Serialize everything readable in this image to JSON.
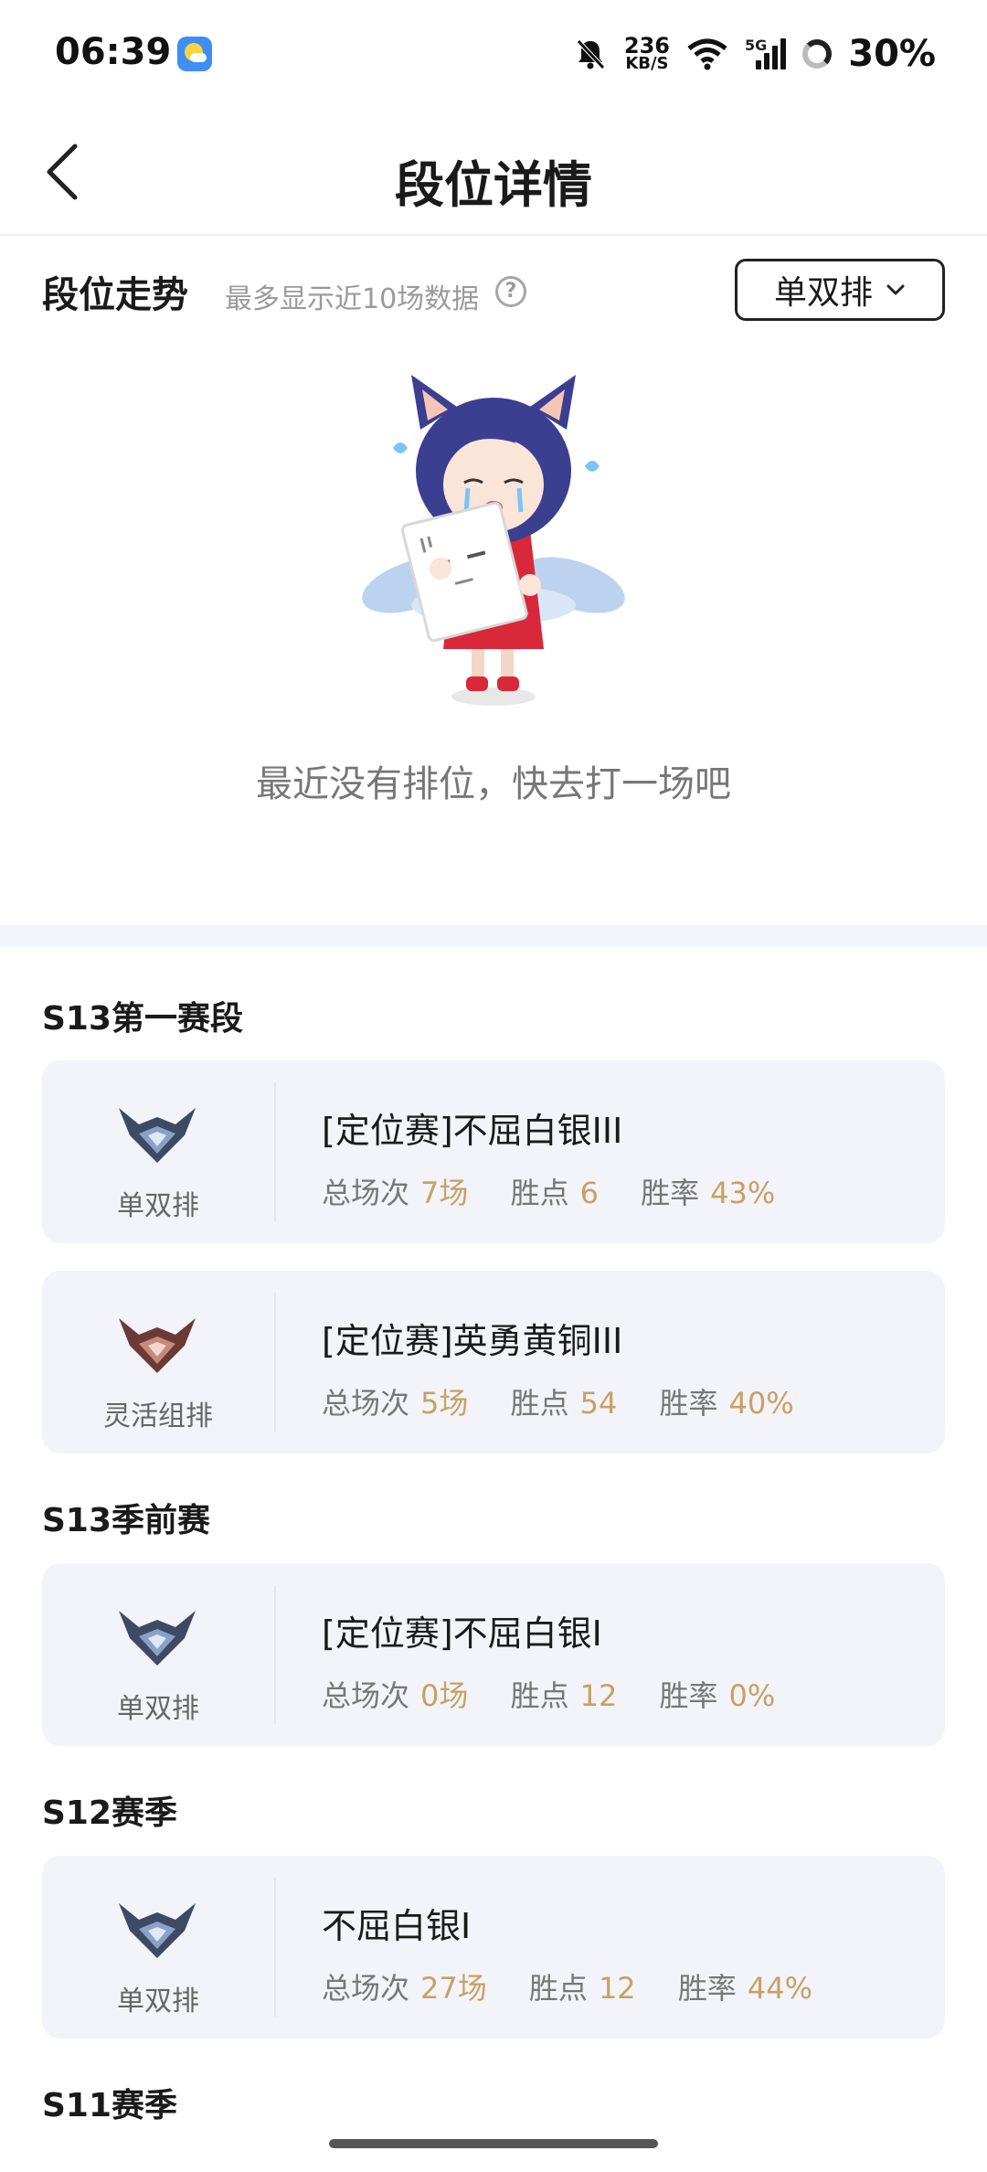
{
  "status_bar": {
    "time": "06:39",
    "net_speed_value": "236",
    "net_speed_unit": "KB/S",
    "network": "5G",
    "battery": "30%"
  },
  "header": {
    "title": "段位详情"
  },
  "trend": {
    "title": "段位走势",
    "hint": "最多显示近10场数据",
    "help_glyph": "?",
    "queue_selector": "单双排",
    "empty_message": "最近没有排位，快去打一场吧"
  },
  "labels": {
    "games": "总场次",
    "lp": "胜点",
    "winrate": "胜率"
  },
  "seasons": [
    {
      "title": "S13第一赛段",
      "cards": [
        {
          "queue": "单双排",
          "rank": "[定位赛]不屈白银III",
          "games": "7场",
          "lp": "6",
          "winrate": "43%",
          "emblem_color": "#3e4a63"
        },
        {
          "queue": "灵活组排",
          "rank": "[定位赛]英勇黄铜III",
          "games": "5场",
          "lp": "54",
          "winrate": "40%",
          "emblem_color": "#6b3a36"
        }
      ]
    },
    {
      "title": "S13季前赛",
      "cards": [
        {
          "queue": "单双排",
          "rank": "[定位赛]不屈白银I",
          "games": "0场",
          "lp": "12",
          "winrate": "0%",
          "emblem_color": "#3e4a63"
        }
      ]
    },
    {
      "title": "S12赛季",
      "cards": [
        {
          "queue": "单双排",
          "rank": "不屈白银I",
          "games": "27场",
          "lp": "12",
          "winrate": "44%",
          "emblem_color": "#3e4a63"
        }
      ]
    },
    {
      "title": "S11赛季",
      "cards": []
    }
  ],
  "colors": {
    "accent_value": "#c9a063",
    "card_bg": "#f2f4fa",
    "band": "#f2f5fa"
  }
}
